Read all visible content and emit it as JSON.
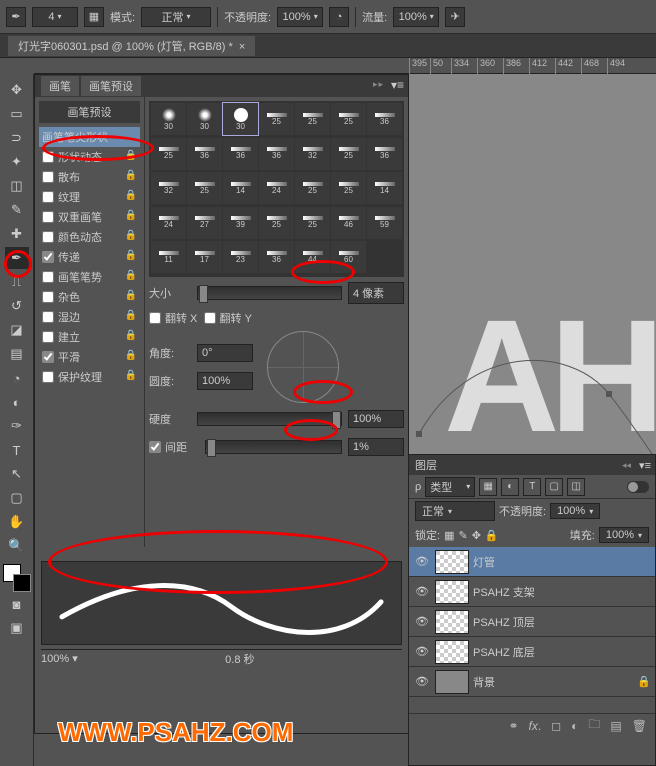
{
  "optbar": {
    "brush_size": "4",
    "mode_label": "模式:",
    "mode_value": "正常",
    "opacity_label": "不透明度:",
    "opacity_value": "100%",
    "flow_label": "流量:",
    "flow_value": "100%"
  },
  "doc_tab": "灯光字060301.psd @ 100% (灯管, RGB/8) *",
  "ruler_ticks": [
    "50",
    "50",
    "50",
    "50",
    "50",
    "50",
    "50",
    "50",
    "395",
    "50",
    "334",
    "360",
    "386",
    "412",
    "442",
    "468",
    "494"
  ],
  "ruler_values": [
    "395",
    "50",
    "334",
    "360",
    "386",
    "412",
    "442",
    "468",
    "494"
  ],
  "canvas_text": "AH",
  "brush_panel": {
    "tab1": "画笔",
    "tab2": "画笔预设",
    "preset_btn": "画笔预设",
    "left_items": [
      {
        "label": "画笔笔尖形状",
        "cb": false,
        "sel": true,
        "lock": false
      },
      {
        "label": "形状动态",
        "cb": true,
        "checked": false,
        "lock": true
      },
      {
        "label": "散布",
        "cb": true,
        "checked": false,
        "lock": true
      },
      {
        "label": "纹理",
        "cb": true,
        "checked": false,
        "lock": true
      },
      {
        "label": "双重画笔",
        "cb": true,
        "checked": false,
        "lock": true
      },
      {
        "label": "颜色动态",
        "cb": true,
        "checked": false,
        "lock": true
      },
      {
        "label": "传递",
        "cb": true,
        "checked": true,
        "lock": true
      },
      {
        "label": "画笔笔势",
        "cb": true,
        "checked": false,
        "lock": true
      },
      {
        "label": "杂色",
        "cb": true,
        "checked": false,
        "lock": true
      },
      {
        "label": "湿边",
        "cb": true,
        "checked": false,
        "lock": true
      },
      {
        "label": "建立",
        "cb": true,
        "checked": false,
        "lock": true
      },
      {
        "label": "平滑",
        "cb": true,
        "checked": true,
        "lock": true
      },
      {
        "label": "保护纹理",
        "cb": true,
        "checked": false,
        "lock": true
      }
    ],
    "grid_sizes": [
      30,
      30,
      30,
      25,
      25,
      25,
      36,
      25,
      36,
      36,
      36,
      32,
      25,
      36,
      32,
      25,
      14,
      24,
      25,
      25,
      14,
      24,
      27,
      39,
      25,
      25,
      46,
      59,
      11,
      17,
      23,
      36,
      44,
      60
    ],
    "size_label": "大小",
    "size_value": "4 像素",
    "flipx": "翻转 X",
    "flipy": "翻转 Y",
    "angle_label": "角度:",
    "angle_value": "0°",
    "round_label": "圆度:",
    "round_value": "100%",
    "hard_label": "硬度",
    "hard_value": "100%",
    "spacing_label": "间距",
    "spacing_value": "1%",
    "zoom": "100%",
    "time": "0.8 秒"
  },
  "layers": {
    "title": "图层",
    "kind": "类型",
    "blend": "正常",
    "opacity_label": "不透明度:",
    "opacity_value": "100%",
    "lock_label": "锁定:",
    "fill_label": "填充:",
    "fill_value": "100%",
    "rows": [
      {
        "name": "灯管",
        "sel": true
      },
      {
        "name": "PSAHZ 支架"
      },
      {
        "name": "PSAHZ 顶层"
      },
      {
        "name": "PSAHZ 底层"
      },
      {
        "name": "背景",
        "bg": true
      }
    ]
  },
  "watermark": "WWW.PSAHZ.COM"
}
